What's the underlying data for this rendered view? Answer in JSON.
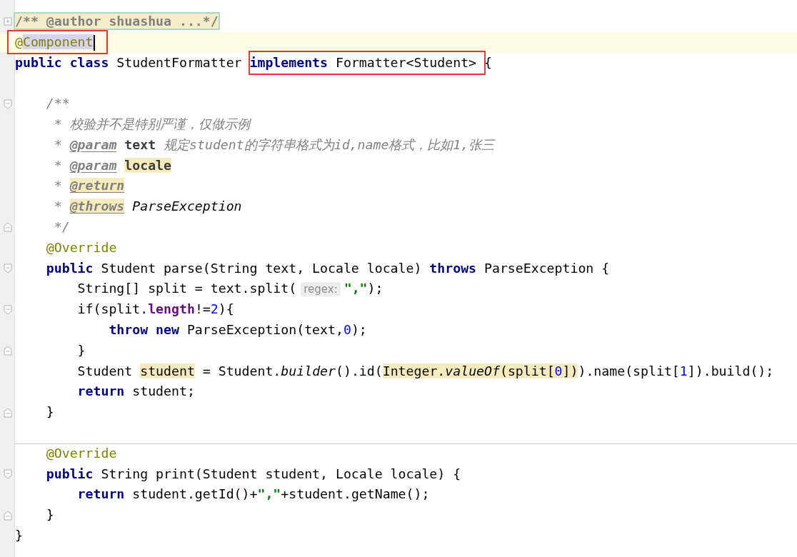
{
  "editor": {
    "lines": [
      {
        "foldable": true,
        "expanded": false,
        "segments": [
          {
            "kind": "code",
            "tokens": [
              {
                "text": "/** @author shuashua ...*/",
                "kind": "folded"
              }
            ]
          }
        ]
      },
      {
        "current": true,
        "segments": [
          {
            "kind": "code",
            "framed": true,
            "caret": true,
            "tokens": [
              {
                "text": "@",
                "kind": "ann"
              },
              {
                "text": "Component",
                "kind": "ann",
                "selected_text": true
              }
            ]
          }
        ]
      },
      {
        "segments": [
          {
            "kind": "code",
            "tokens": [
              {
                "text": "public class",
                "kind": "kw"
              },
              {
                "text": " StudentFormatter ",
                "kind": "plain"
              }
            ]
          },
          {
            "kind": "code",
            "framed": true,
            "tokens": [
              {
                "text": "implements",
                "kind": "kw"
              },
              {
                "text": " Formatter<Student> ",
                "kind": "plain"
              }
            ]
          },
          {
            "kind": "code",
            "tokens": [
              {
                "text": "{",
                "kind": "plain"
              }
            ]
          }
        ]
      },
      {
        "kind": "blank"
      },
      {
        "foldable": true,
        "expanded": true,
        "segments": [
          {
            "kind": "code",
            "tokens": [
              {
                "text": "    /**",
                "kind": "comment"
              }
            ]
          }
        ]
      },
      {
        "segments": [
          {
            "kind": "code",
            "tokens": [
              {
                "text": "     * 校验并不是特别严谨，仅做示例",
                "kind": "comment"
              }
            ]
          }
        ]
      },
      {
        "segments": [
          {
            "kind": "code",
            "tokens": [
              {
                "text": "     * ",
                "kind": "comment"
              },
              {
                "text": "@param",
                "kind": "doctag"
              },
              {
                "text": " text",
                "kind": "docname"
              },
              {
                "text": " 规定student的字符串格式为id,name格式，比如1,张三",
                "kind": "comment"
              }
            ]
          }
        ]
      },
      {
        "segments": [
          {
            "kind": "code",
            "tokens": [
              {
                "text": "     * ",
                "kind": "comment"
              },
              {
                "text": "@param",
                "kind": "doctag"
              },
              {
                "text": " locale",
                "kind": "docname",
                "usage": true
              }
            ]
          }
        ]
      },
      {
        "segments": [
          {
            "kind": "code",
            "tokens": [
              {
                "text": "     * ",
                "kind": "comment"
              },
              {
                "text": "@return",
                "kind": "doctag",
                "usage": true
              }
            ]
          }
        ]
      },
      {
        "segments": [
          {
            "kind": "code",
            "tokens": [
              {
                "text": "     * ",
                "kind": "comment"
              },
              {
                "text": "@throws",
                "kind": "doctag",
                "usage": true
              },
              {
                "text": " ParseException",
                "kind": "doctype"
              }
            ]
          }
        ]
      },
      {
        "fold_end": true,
        "segments": [
          {
            "kind": "code",
            "tokens": [
              {
                "text": "     */",
                "kind": "comment"
              }
            ]
          }
        ]
      },
      {
        "segments": [
          {
            "kind": "code",
            "tokens": [
              {
                "text": "    @Override",
                "kind": "ann"
              }
            ]
          }
        ]
      },
      {
        "foldable": true,
        "expanded": true,
        "segments": [
          {
            "kind": "code",
            "tokens": [
              {
                "text": "    public",
                "kind": "kw"
              },
              {
                "text": " Student parse(String text, Locale locale) ",
                "kind": "plain"
              },
              {
                "text": "throws",
                "kind": "kw"
              },
              {
                "text": " ParseException {",
                "kind": "plain"
              }
            ]
          }
        ]
      },
      {
        "segments": [
          {
            "kind": "code",
            "tokens": [
              {
                "text": "        String[] split = text.split(",
                "kind": "plain"
              }
            ]
          },
          {
            "kind": "hint",
            "text": "regex:"
          },
          {
            "kind": "code",
            "tokens": [
              {
                "text": "\",\"",
                "kind": "str"
              },
              {
                "text": ");",
                "kind": "plain"
              }
            ]
          }
        ]
      },
      {
        "foldable": true,
        "expanded": true,
        "segments": [
          {
            "kind": "code",
            "tokens": [
              {
                "text": "        if(split.",
                "kind": "plain"
              },
              {
                "text": "length",
                "kind": "field"
              },
              {
                "text": "!=",
                "kind": "plain"
              },
              {
                "text": "2",
                "kind": "num"
              },
              {
                "text": "){",
                "kind": "plain"
              }
            ]
          }
        ]
      },
      {
        "segments": [
          {
            "kind": "code",
            "tokens": [
              {
                "text": "            throw new",
                "kind": "kw"
              },
              {
                "text": " ParseException(text,",
                "kind": "plain"
              },
              {
                "text": "0",
                "kind": "num"
              },
              {
                "text": ");",
                "kind": "plain"
              }
            ]
          }
        ]
      },
      {
        "fold_end": true,
        "segments": [
          {
            "kind": "code",
            "tokens": [
              {
                "text": "        }",
                "kind": "plain"
              }
            ]
          }
        ]
      },
      {
        "segments": [
          {
            "kind": "code",
            "tokens": [
              {
                "text": "        Student ",
                "kind": "plain"
              },
              {
                "text": "student",
                "kind": "plain",
                "usage": true
              },
              {
                "text": " = Student.",
                "kind": "plain"
              },
              {
                "text": "builder",
                "kind": "italic"
              },
              {
                "text": "().id(",
                "kind": "plain"
              },
              {
                "text": "Integer.",
                "kind": "plain",
                "usage": true
              },
              {
                "text": "valueOf",
                "kind": "italic",
                "usage": true
              },
              {
                "text": "(split[",
                "kind": "plain",
                "usage": true
              },
              {
                "text": "0",
                "kind": "num",
                "usage": true
              },
              {
                "text": "])",
                "kind": "plain",
                "usage": true
              },
              {
                "text": ").name(split[",
                "kind": "plain"
              },
              {
                "text": "1",
                "kind": "num"
              },
              {
                "text": "]).build();",
                "kind": "plain"
              }
            ]
          }
        ]
      },
      {
        "segments": [
          {
            "kind": "code",
            "tokens": [
              {
                "text": "        return",
                "kind": "kw"
              },
              {
                "text": " student;",
                "kind": "plain"
              }
            ]
          }
        ]
      },
      {
        "fold_end": true,
        "segments": [
          {
            "kind": "code",
            "tokens": [
              {
                "text": "    }",
                "kind": "plain"
              }
            ]
          }
        ]
      },
      {
        "kind": "blank"
      },
      {
        "separator": true,
        "segments": [
          {
            "kind": "code",
            "tokens": [
              {
                "text": "    @Override",
                "kind": "ann"
              }
            ]
          }
        ]
      },
      {
        "foldable": true,
        "expanded": true,
        "segments": [
          {
            "kind": "code",
            "tokens": [
              {
                "text": "    public",
                "kind": "kw"
              },
              {
                "text": " String print(Student student, Locale locale) {",
                "kind": "plain"
              }
            ]
          }
        ]
      },
      {
        "segments": [
          {
            "kind": "code",
            "tokens": [
              {
                "text": "        return",
                "kind": "kw"
              },
              {
                "text": " student.getId()+",
                "kind": "plain"
              },
              {
                "text": "\",\"",
                "kind": "str"
              },
              {
                "text": "+student.getName();",
                "kind": "plain"
              }
            ]
          }
        ]
      },
      {
        "fold_end": true,
        "segments": [
          {
            "kind": "code",
            "tokens": [
              {
                "text": "    }",
                "kind": "plain"
              }
            ]
          }
        ]
      },
      {
        "segments": [
          {
            "kind": "code",
            "tokens": [
              {
                "text": "}",
                "kind": "plain"
              }
            ]
          }
        ]
      }
    ]
  }
}
